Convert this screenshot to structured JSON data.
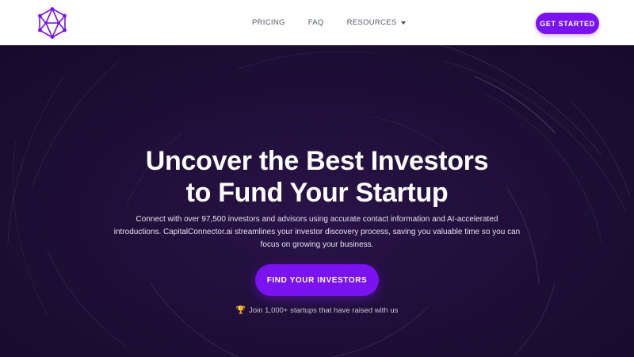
{
  "nav": {
    "links": [
      {
        "label": "PRICING"
      },
      {
        "label": "FAQ"
      },
      {
        "label": "RESOURCES"
      }
    ],
    "cta_label": "GET STARTED"
  },
  "hero": {
    "headline_line1": "Uncover the Best Investors",
    "headline_line2": "to Fund Your Startup",
    "description_line1": "Connect with over 97,500 investors and advisors using accurate contact information and AI-accelerated",
    "description_line2": "introductions. CapitalConnector.ai streamlines your investor discovery process, saving you valuable time so you can",
    "description_line3": "focus on growing your business.",
    "cta_label": "FIND YOUR INVESTORS",
    "social_proof": "Join 1,000+ startups that have raised with us"
  },
  "icons": {
    "logo": "network-polyhedron-icon",
    "resources_caret": "caret-down-icon",
    "social_proof": "trophy-icon"
  },
  "colors": {
    "accent": "#7b12f0",
    "hero_background": "#1e0e36",
    "nav_background": "#ffffff",
    "nav_text": "#555b66"
  }
}
